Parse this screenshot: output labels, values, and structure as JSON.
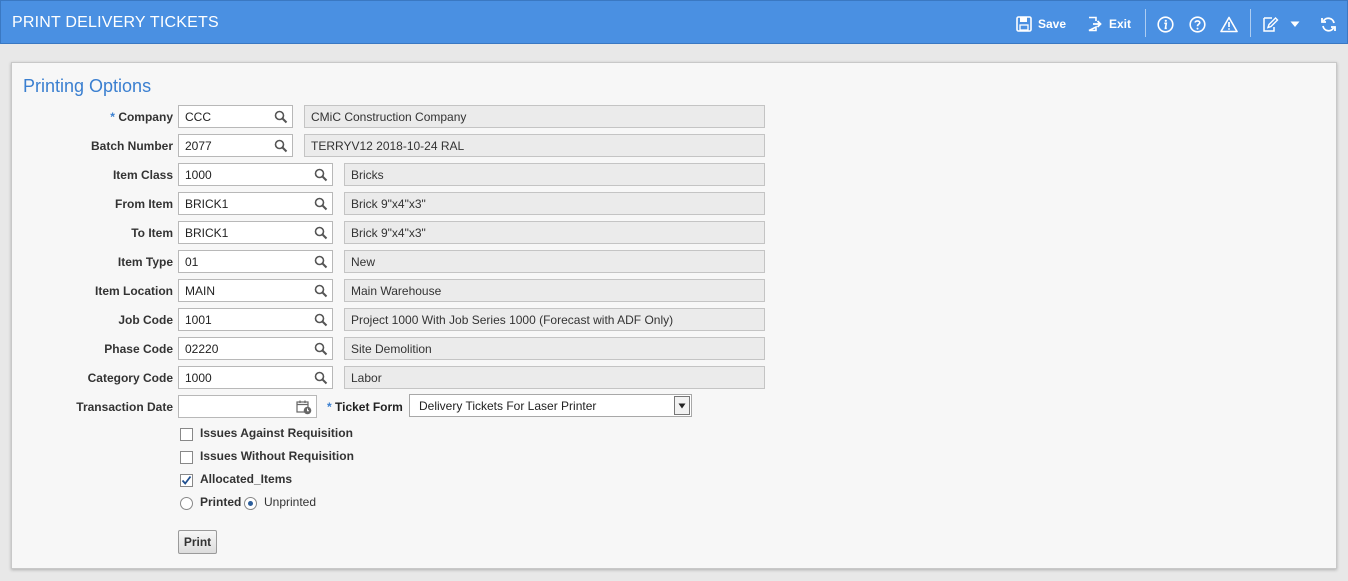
{
  "header": {
    "title": "PRINT DELIVERY TICKETS",
    "save_label": "Save",
    "exit_label": "Exit"
  },
  "section": {
    "title": "Printing Options"
  },
  "fields": {
    "company": {
      "required_mark": "*",
      "label": "Company",
      "value": "CCC",
      "description": "CMiC Construction Company"
    },
    "batch_number": {
      "label": "Batch Number",
      "value": "2077",
      "description": "TERRYV12 2018-10-24 RAL"
    },
    "item_class": {
      "label": "Item Class",
      "value": "1000",
      "description": "Bricks"
    },
    "from_item": {
      "label": "From Item",
      "value": "BRICK1",
      "description": "Brick 9\"x4\"x3\""
    },
    "to_item": {
      "label": "To Item",
      "value": "BRICK1",
      "description": "Brick 9\"x4\"x3\""
    },
    "item_type": {
      "label": "Item Type",
      "value": "01",
      "description": "New"
    },
    "item_location": {
      "label": "Item Location",
      "value": "MAIN",
      "description": "Main Warehouse"
    },
    "job_code": {
      "label": "Job Code",
      "value": "1001",
      "description": "Project 1000 With Job Series 1000 (Forecast with ADF Only)"
    },
    "phase_code": {
      "label": "Phase Code",
      "value": "02220",
      "description": "Site Demolition"
    },
    "category_code": {
      "label": "Category Code",
      "value": "1000",
      "description": "Labor"
    },
    "transaction_date": {
      "label": "Transaction Date",
      "value": ""
    },
    "ticket_form": {
      "required_mark": "*",
      "label": "Ticket Form",
      "value": "Delivery Tickets For Laser Printer"
    }
  },
  "options": {
    "issues_against_requisition": {
      "label": "Issues Against Requisition",
      "checked": false
    },
    "issues_without_requisition": {
      "label": "Issues Without Requisition",
      "checked": false
    },
    "allocated_items": {
      "label": "Allocated_Items",
      "checked": true
    },
    "print_status": {
      "printed_label": "Printed",
      "unprinted_label": "Unprinted",
      "selected": "Unprinted"
    }
  },
  "actions": {
    "print_label": "Print"
  },
  "colors": {
    "header_bg": "#4a90e2",
    "accent": "#3a7fd0",
    "readonly_bg": "#ebebeb"
  }
}
